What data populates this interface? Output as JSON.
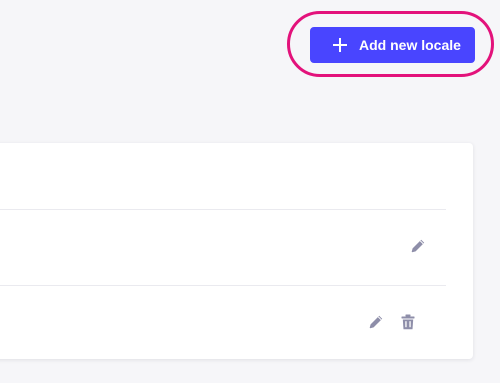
{
  "header": {
    "add_button_label": "Add new locale",
    "add_button_icon": "plus-icon"
  },
  "colors": {
    "primary": "#4945ff",
    "highlight": "#e3127b",
    "icon": "#8e8ea9",
    "background": "#f6f6f9"
  },
  "locales_table": {
    "rows": [
      {
        "actions": [
          "pencil-icon"
        ]
      },
      {
        "actions": [
          "pencil-icon",
          "trash-icon"
        ]
      }
    ]
  }
}
